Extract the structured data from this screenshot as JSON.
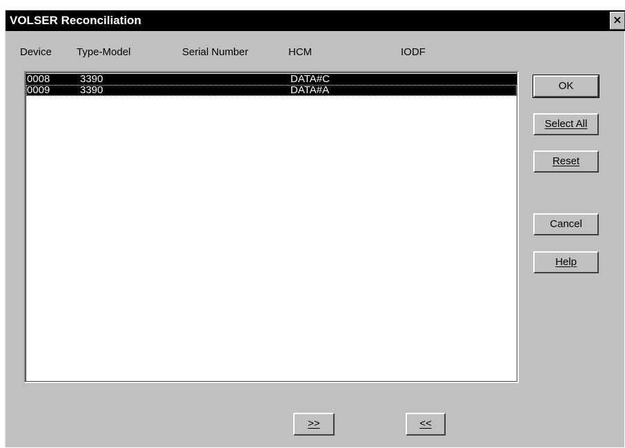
{
  "dialog": {
    "title": "VOLSER Reconciliation",
    "close_symbol": "×"
  },
  "columns": [
    "Device",
    "Type-Model",
    "Serial Number",
    "HCM",
    "IODF"
  ],
  "rows": [
    {
      "device": "0008",
      "type_model": "3390",
      "serial_number": "",
      "hcm": "DATA#C",
      "iodf": ""
    },
    {
      "device": "0009",
      "type_model": "3390",
      "serial_number": "",
      "hcm": "DATA#A",
      "iodf": ""
    }
  ],
  "buttons": {
    "ok": "OK",
    "select_all": "Select All",
    "reset": "Reset",
    "cancel": "Cancel",
    "help": "Help",
    "move_right": ">>",
    "move_left": "<<"
  },
  "colors": {
    "titlebar_bg": "#000000",
    "dialog_bg": "#c0c0c0",
    "selection_bg": "#000000",
    "selection_fg": "#ffffff"
  }
}
